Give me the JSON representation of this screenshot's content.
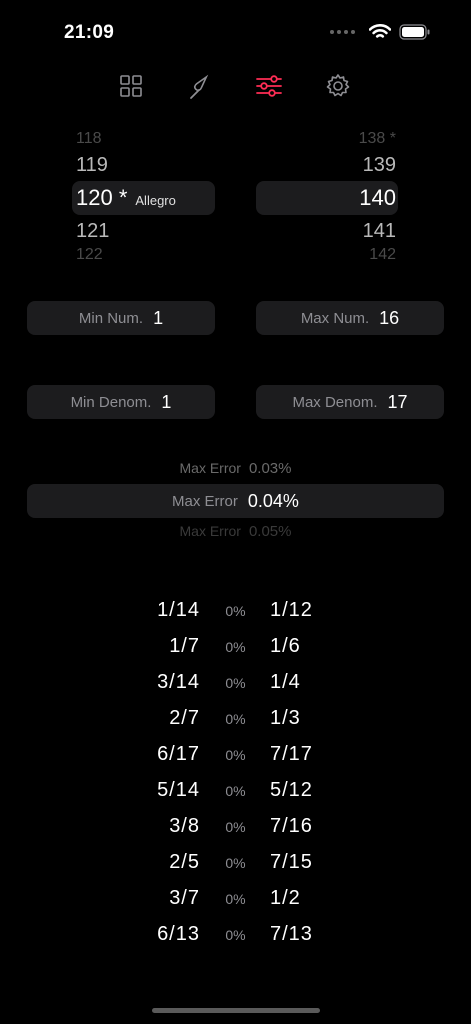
{
  "status": {
    "time": "21:09"
  },
  "tabs": [
    {
      "id": "grid",
      "icon": "grid-icon"
    },
    {
      "id": "tuning-fork",
      "icon": "tuning-fork-icon"
    },
    {
      "id": "sliders",
      "icon": "sliders-icon",
      "active": true
    },
    {
      "id": "settings",
      "icon": "gear-icon"
    }
  ],
  "colors": {
    "accent": "#ff2d55",
    "pill": "#1c1c1e",
    "muted": "#8e8e93"
  },
  "tempo_picker": {
    "left_rows": [
      "118",
      "119",
      "120 *",
      "121",
      "122"
    ],
    "right_rows": [
      "138 *",
      "139",
      "140",
      "141",
      "142"
    ],
    "tempo_name": "Allegro"
  },
  "fields": {
    "min_num": {
      "label": "Min Num.",
      "value": "1"
    },
    "max_num": {
      "label": "Max Num.",
      "value": "16"
    },
    "min_denom": {
      "label": "Min Denom.",
      "value": "1"
    },
    "max_denom": {
      "label": "Max Denom.",
      "value": "17"
    }
  },
  "max_error": {
    "label": "Max Error",
    "above": "0.03%",
    "selected": "0.04%",
    "below": "0.05%"
  },
  "results": [
    {
      "a": "1/14",
      "pct": "0%",
      "b": "1/12"
    },
    {
      "a": "1/7",
      "pct": "0%",
      "b": "1/6"
    },
    {
      "a": "3/14",
      "pct": "0%",
      "b": "1/4"
    },
    {
      "a": "2/7",
      "pct": "0%",
      "b": "1/3"
    },
    {
      "a": "6/17",
      "pct": "0%",
      "b": "7/17"
    },
    {
      "a": "5/14",
      "pct": "0%",
      "b": "5/12"
    },
    {
      "a": "3/8",
      "pct": "0%",
      "b": "7/16"
    },
    {
      "a": "2/5",
      "pct": "0%",
      "b": "7/15"
    },
    {
      "a": "3/7",
      "pct": "0%",
      "b": "1/2"
    },
    {
      "a": "6/13",
      "pct": "0%",
      "b": "7/13"
    }
  ]
}
